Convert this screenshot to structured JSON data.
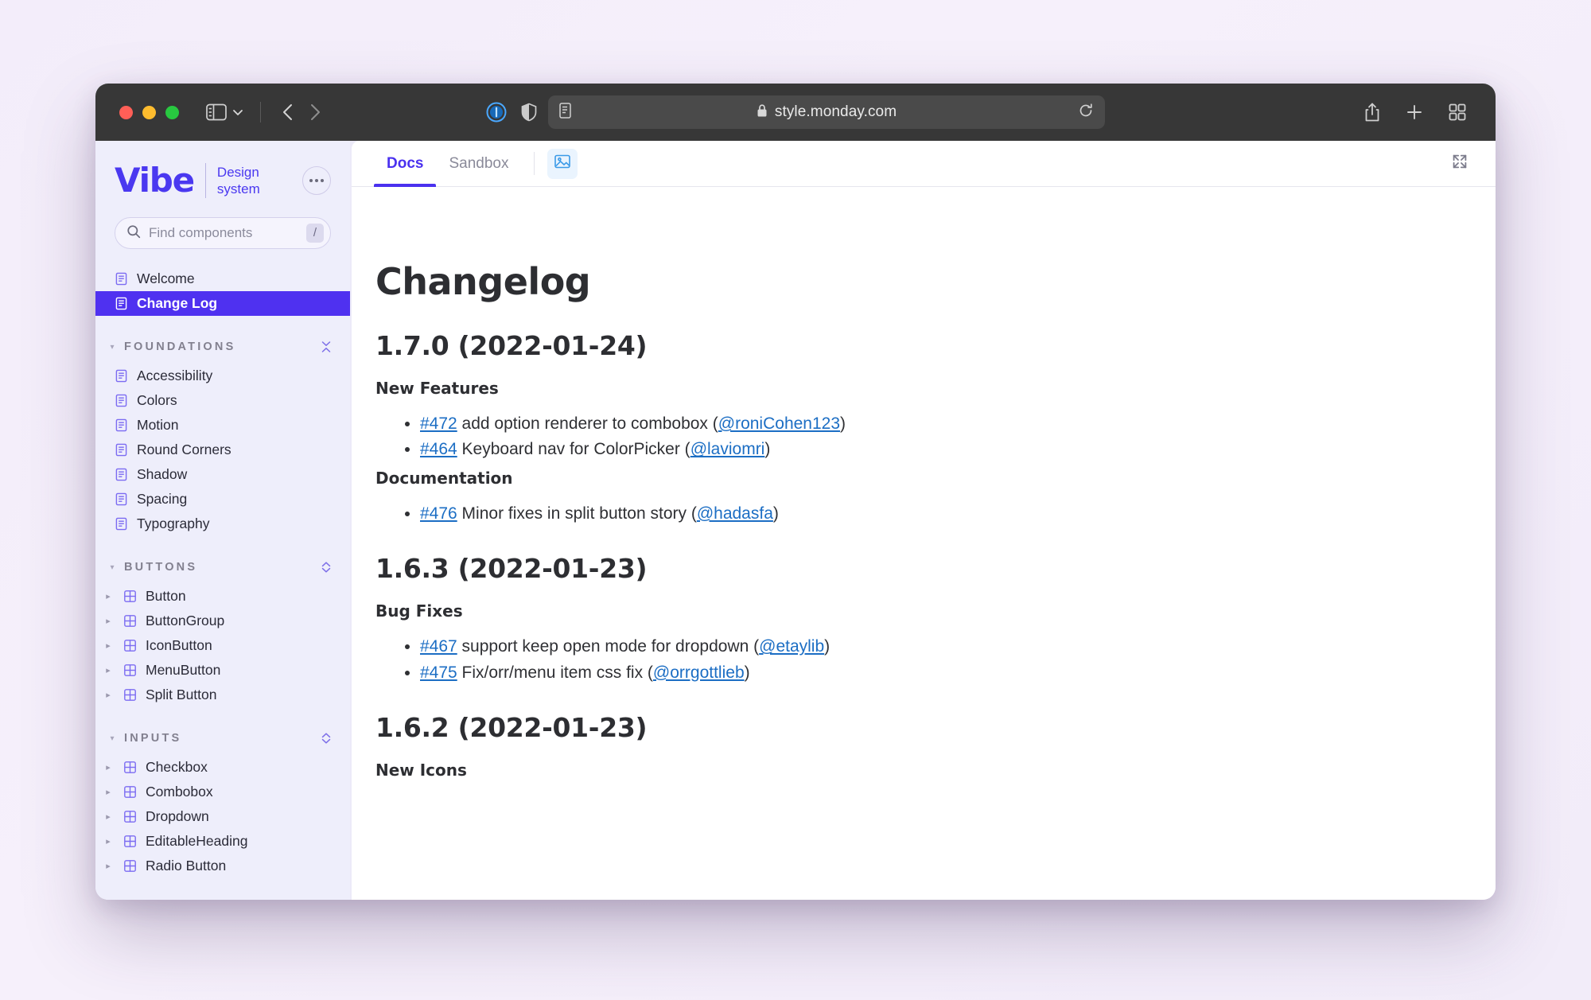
{
  "browser": {
    "url": "style.monday.com",
    "lock_icon": "lock-icon",
    "reload_icon": "reload-icon",
    "back_icon": "back-chevron-icon",
    "forward_icon": "forward-chevron-icon",
    "sidebar_icon": "sidebar-toggle-icon",
    "tab_group_chevron": "chevron-down-icon",
    "onepassword_icon": "1password-icon",
    "shield_icon": "privacy-shield-icon",
    "reader_icon": "reader-view-icon",
    "share_icon": "share-icon",
    "newtab_icon": "plus-icon",
    "tabs_overview_icon": "tab-overview-icon"
  },
  "sidebar": {
    "brand": {
      "logo_text": "Vibe",
      "sub_line1": "Design",
      "sub_line2": "system",
      "more_button_label": "more-options"
    },
    "search": {
      "placeholder": "Find components",
      "value": "",
      "shortcut": "/",
      "icon": "search-icon"
    },
    "top_items": [
      {
        "label": "Welcome",
        "icon": "document-icon",
        "active": false
      },
      {
        "label": "Change Log",
        "icon": "document-icon",
        "active": true
      }
    ],
    "sections": [
      {
        "title": "FOUNDATIONS",
        "action_icon": "collapse-chevrons-icon",
        "items": [
          {
            "label": "Accessibility",
            "icon": "document-icon"
          },
          {
            "label": "Colors",
            "icon": "document-icon"
          },
          {
            "label": "Motion",
            "icon": "document-icon"
          },
          {
            "label": "Round Corners",
            "icon": "document-icon"
          },
          {
            "label": "Shadow",
            "icon": "document-icon"
          },
          {
            "label": "Spacing",
            "icon": "document-icon"
          },
          {
            "label": "Typography",
            "icon": "document-icon"
          }
        ]
      },
      {
        "title": "BUTTONS",
        "action_icon": "expand-chevrons-icon",
        "items": [
          {
            "label": "Button",
            "icon": "component-icon",
            "expandable": true
          },
          {
            "label": "ButtonGroup",
            "icon": "component-icon",
            "expandable": true
          },
          {
            "label": "IconButton",
            "icon": "component-icon",
            "expandable": true
          },
          {
            "label": "MenuButton",
            "icon": "component-icon",
            "expandable": true
          },
          {
            "label": "Split Button",
            "icon": "component-icon",
            "expandable": true
          }
        ]
      },
      {
        "title": "INPUTS",
        "action_icon": "expand-chevrons-icon",
        "items": [
          {
            "label": "Checkbox",
            "icon": "component-icon",
            "expandable": true
          },
          {
            "label": "Combobox",
            "icon": "component-icon",
            "expandable": true
          },
          {
            "label": "Dropdown",
            "icon": "component-icon",
            "expandable": true
          },
          {
            "label": "EditableHeading",
            "icon": "component-icon",
            "expandable": true
          },
          {
            "label": "Radio Button",
            "icon": "component-icon",
            "expandable": true
          }
        ]
      }
    ]
  },
  "main": {
    "tabs": [
      {
        "label": "Docs",
        "active": true
      },
      {
        "label": "Sandbox",
        "active": false
      }
    ],
    "image_tab_icon": "image-icon",
    "expand_icon": "fullscreen-expand-icon",
    "title": "Changelog",
    "releases": [
      {
        "version": "1.7.0 (2022-01-24)",
        "groups": [
          {
            "heading": "New Features",
            "items": [
              {
                "id": "#472",
                "text": " add option renderer to combobox (",
                "author": "@roniCohen123",
                "close": ")"
              },
              {
                "id": "#464",
                "text": " Keyboard nav for ColorPicker (",
                "author": "@laviomri",
                "close": ")"
              }
            ]
          },
          {
            "heading": "Documentation",
            "items": [
              {
                "id": "#476",
                "text": " Minor fixes in split button story (",
                "author": "@hadasfa",
                "close": ")"
              }
            ]
          }
        ]
      },
      {
        "version": "1.6.3 (2022-01-23)",
        "groups": [
          {
            "heading": "Bug Fixes",
            "items": [
              {
                "id": "#467",
                "text": " support keep open mode for dropdown (",
                "author": "@etaylib",
                "close": ")"
              },
              {
                "id": "#475",
                "text": " Fix/orr/menu item css fix (",
                "author": "@orrgottlieb",
                "close": ")"
              }
            ]
          }
        ]
      },
      {
        "version": "1.6.2 (2022-01-23)",
        "groups": [
          {
            "heading": "New Icons",
            "items": []
          }
        ]
      }
    ]
  },
  "colors": {
    "accent": "#4a31ef",
    "link": "#1c6ec4",
    "sidebar_bg": "#eeeefb",
    "titlebar_bg": "#373737",
    "page_bg": "#f3edfa"
  }
}
